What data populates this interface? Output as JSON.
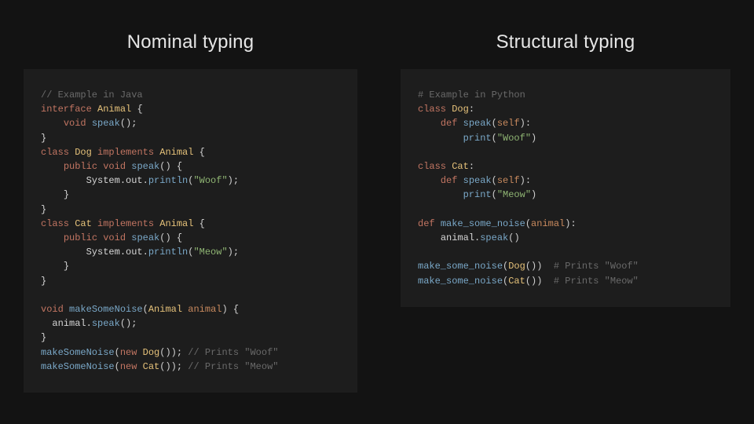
{
  "left": {
    "title": "Nominal typing",
    "lang_comment": "// Example in Java",
    "kw_interface": "interface",
    "kw_class": "class",
    "kw_implements": "implements",
    "kw_public": "public",
    "kw_void": "void",
    "kw_new": "new",
    "type_animal": "Animal",
    "type_dog": "Dog",
    "type_cat": "Cat",
    "fn_speak": "speak",
    "fn_println": "println",
    "fn_makeSomeNoise": "makeSomeNoise",
    "sys_out": "System.out.",
    "str_woof": "\"Woof\"",
    "str_meow": "\"Meow\"",
    "var_animal": "animal",
    "cmt_prints_woof": "// Prints \"Woof\"",
    "cmt_prints_meow": "// Prints \"Meow\""
  },
  "right": {
    "title": "Structural typing",
    "lang_comment": "# Example in Python",
    "kw_class": "class",
    "kw_def": "def",
    "type_dog": "Dog",
    "type_cat": "Cat",
    "fn_speak": "speak",
    "fn_print": "print",
    "fn_make_some_noise": "make_some_noise",
    "arg_self": "self",
    "arg_animal": "animal",
    "str_woof": "\"Woof\"",
    "str_meow": "\"Meow\"",
    "cmt_prints_woof": "# Prints \"Woof\"",
    "cmt_prints_meow": "# Prints \"Meow\""
  }
}
